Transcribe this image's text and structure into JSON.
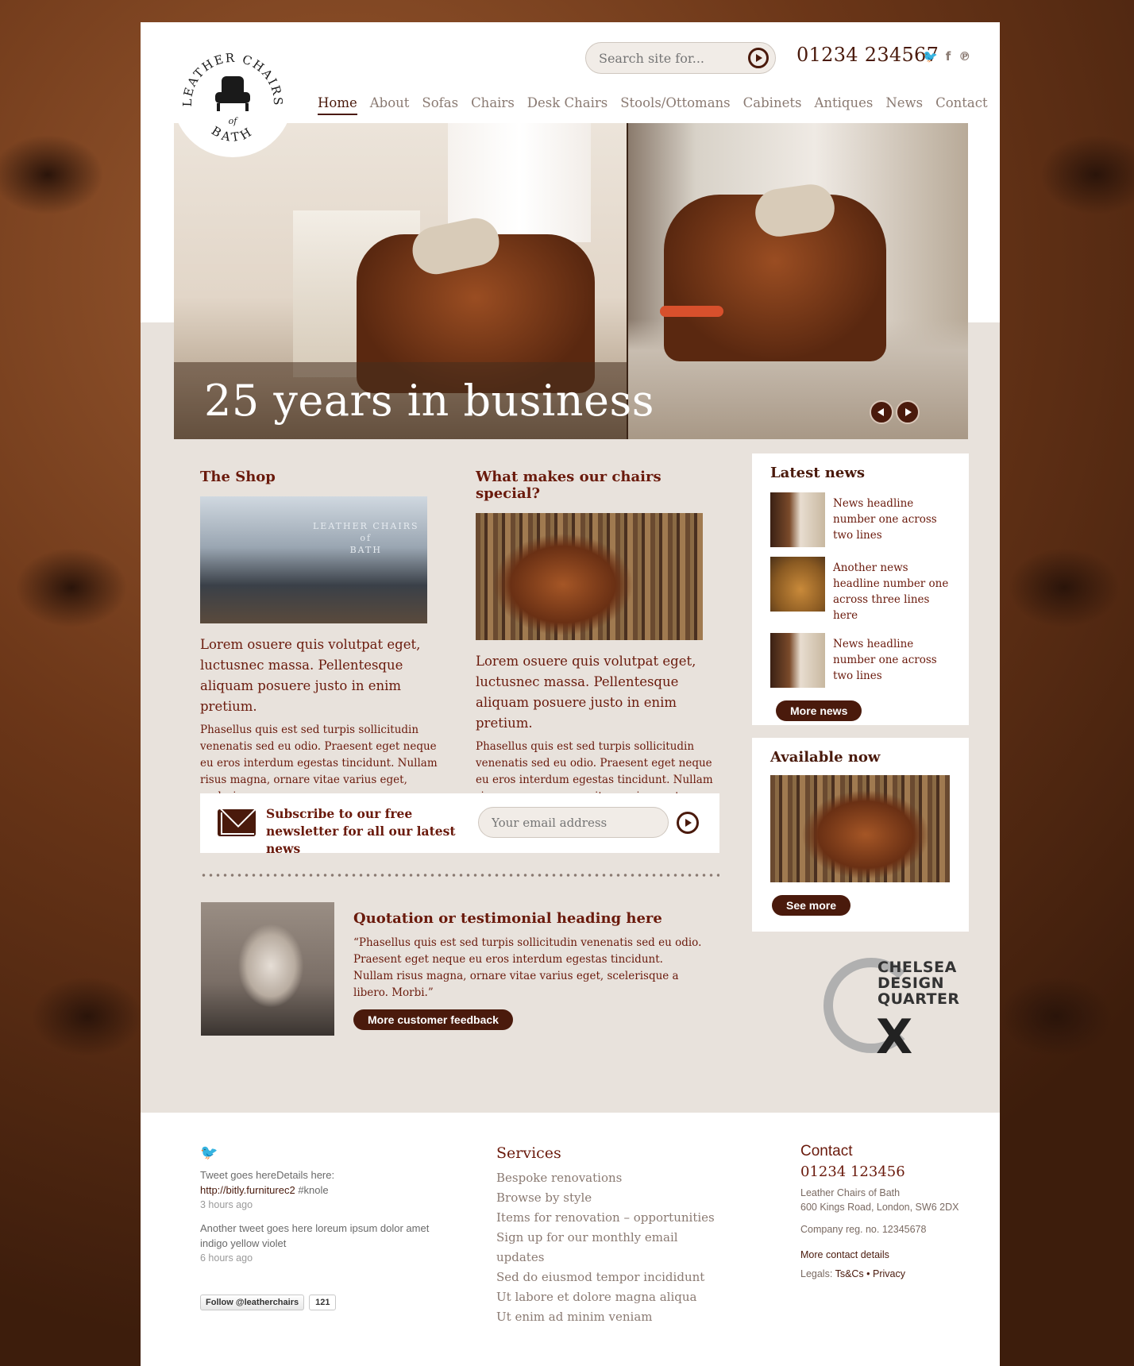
{
  "brand": {
    "logo_top": "LEATHER CHAIRS",
    "logo_of": "of",
    "logo_bottom": "BATH"
  },
  "header": {
    "search_placeholder": "Search site for...",
    "phone": "01234 234567",
    "social": [
      "twitter-icon",
      "facebook-icon",
      "pinterest-icon"
    ],
    "social_glyphs": [
      "🐦",
      "f",
      "℗"
    ]
  },
  "nav": [
    "Home",
    "About",
    "Sofas",
    "Chairs",
    "Desk Chairs",
    "Stools/Ottomans",
    "Cabinets",
    "Antiques",
    "News",
    "Contact"
  ],
  "nav_active": "Home",
  "hero": {
    "caption": "25 years in business"
  },
  "shop": {
    "title": "The Shop",
    "sign": "LEATHER CHAIRS\nof\nBATH",
    "lead": "Lorem osuere quis volutpat eget, luctusnec massa. Pellentesque aliquam posuere justo in enim pretium.",
    "body": "Phasellus quis est sed turpis sollicitudin venenatis sed eu odio. Praesent eget neque eu eros interdum egestas tincidunt. Nullam risus magna, ornare vitae varius eget, scelerisque."
  },
  "special": {
    "title": "What makes our chairs special?",
    "lead": "Lorem osuere quis volutpat eget, luctusnec massa. Pellentesque aliquam posuere justo in enim pretium.",
    "body": "Phasellus quis est sed turpis sollicitudin venenatis sed eu odio. Praesent eget neque eu eros interdum egestas tincidunt. Nullam risus magna, ornare vitae varius eget, scelerisque."
  },
  "latest_news": {
    "title": "Latest news",
    "items": [
      "News headline number one across two lines",
      "Another news headline number one across three lines here",
      "News headline number one across two lines"
    ],
    "button": "More news"
  },
  "available": {
    "title": "Available now",
    "button": "See more"
  },
  "newsletter": {
    "text": "Subscribe to our free newsletter for all our latest news",
    "placeholder": "Your email address"
  },
  "testimonial": {
    "title": "Quotation or testimonial heading here",
    "quote": "“Phasellus quis est sed turpis sollicitudin venenatis sed eu odio. Praesent eget neque eu eros interdum  egestas tincidunt. Nullam risus magna, ornare vitae varius eget, scelerisque a libero. Morbi.”",
    "button": "More customer feedback"
  },
  "partner": {
    "lines": "CHELSEA\nDESIGN\nQUARTER",
    "mark": "X"
  },
  "footer": {
    "tweets": [
      {
        "text": "Tweet goes hereDetails here:",
        "link": "http://bitly.furniturec2",
        "tag": " #knole",
        "ago": "3 hours ago"
      },
      {
        "text": "Another tweet goes here loreum ipsum dolor amet indigo yellow violet",
        "ago": "6 hours ago"
      }
    ],
    "follow_button": "Follow @leatherchairs",
    "follow_count": "121",
    "services_title": "Services",
    "services": [
      "Bespoke renovations",
      "Browse by style",
      "Items for renovation – opportunities",
      "Sign up for our monthly email updates",
      "Sed do eiusmod tempor incididunt",
      "Ut labore et dolore magna aliqua",
      "Ut enim ad minim veniam"
    ],
    "contact_title": "Contact",
    "contact_phone": "01234 123456",
    "address_line1": "Leather Chairs of Bath",
    "address_line2": "600 Kings Road, London, SW6 2DX",
    "company_reg": "Company reg. no. 12345678",
    "more_contact": "More contact details",
    "legals_label": "Legals: ",
    "tscs": "Ts&Cs",
    "bullet": " • ",
    "privacy": "Privacy"
  }
}
